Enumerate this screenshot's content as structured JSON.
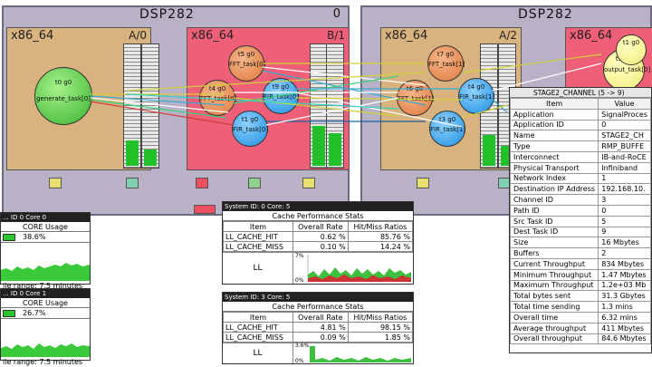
{
  "systems": [
    {
      "title": "DSP282",
      "number": "0",
      "nodes": [
        {
          "label": "x86_64",
          "core": "A/0"
        },
        {
          "label": "x86_64",
          "core": "B/1"
        }
      ],
      "tasks": [
        {
          "id": "t0 g0",
          "name": "generate_task[0]"
        },
        {
          "id": "t5 g0",
          "name": "FFT_task[0]"
        },
        {
          "id": "t4 g0",
          "name": "FFT_task[0]"
        },
        {
          "id": "t9 g0",
          "name": "FIR_task[0]"
        },
        {
          "id": "t1 g0",
          "name": "FIR_task[0]"
        }
      ]
    },
    {
      "title": "DSP282",
      "nodes": [
        {
          "label": "x86_64",
          "core": "A/2"
        },
        {
          "label": "x86_64"
        }
      ],
      "tasks": [
        {
          "id": "t7 g0",
          "name": "FFT_task[1]"
        },
        {
          "id": "t6 g0",
          "name": "FFT_task[1]"
        },
        {
          "id": "t4 g0",
          "name": "FIR_task[1]"
        },
        {
          "id": "t3 g0",
          "name": "FIR_task[1]"
        },
        {
          "id": "t1 g0",
          "name": "output_task[0]"
        },
        {
          "id": "t1 g0",
          "name": ""
        }
      ]
    }
  ],
  "core_windows": [
    {
      "title": "... ID 0 Core 0",
      "heading": "CORE Usage",
      "value": "38.6%",
      "range": "ile range: 7.5 minutes"
    },
    {
      "title": "... ID 0 Core 1",
      "heading": "CORE Usage",
      "value": "26.7%",
      "range": "ile range: 7.5 minutes"
    }
  ],
  "cache_windows": [
    {
      "title": "System ID: 0 Core: 5",
      "heading": "Cache Performance Stats",
      "columns": [
        "Item",
        "Overall Rate",
        "Hit/Miss Ratios"
      ],
      "rows": [
        [
          "LL_CACHE_HIT",
          "0.62 %",
          "85.76 %"
        ],
        [
          "LL_CACHE_MISS",
          "0.10 %",
          "14.24 %"
        ]
      ],
      "graph_label": "LL",
      "graph_max": "7%",
      "graph_min": "0%"
    },
    {
      "title": "System ID: 3 Core: 5",
      "heading": "Cache Performance Stats",
      "columns": [
        "Item",
        "Overall Rate",
        "Hit/Miss Ratios"
      ],
      "rows": [
        [
          "LL_CACHE_HIT",
          "4.81 %",
          "98.15 %"
        ],
        [
          "LL_CACHE_MISS",
          "0.09 %",
          "1.85 %"
        ]
      ],
      "graph_label": "LL",
      "graph_max": "3.6%",
      "graph_min": "0%"
    }
  ],
  "channel_window": {
    "title": "STAGE2_CHANNEL (5 -> 9)",
    "columns": [
      "Item",
      "Value"
    ],
    "rows": [
      [
        "Application",
        "SignalProces"
      ],
      [
        "Application ID",
        "0"
      ],
      [
        "Name",
        "STAGE2_CH"
      ],
      [
        "Type",
        "RMP_BUFFE"
      ],
      [
        "Interconnect",
        "IB-and-RoCE"
      ],
      [
        "Physical Transport",
        "Infiniband"
      ],
      [
        "Network Index",
        "1"
      ],
      [
        "Destination IP Address",
        "192.168.10."
      ],
      [
        "Channel ID",
        "3"
      ],
      [
        "Path ID",
        "0"
      ],
      [
        "Src Task ID",
        "5"
      ],
      [
        "Dest Task ID",
        "9"
      ],
      [
        "Size",
        "16 Mbytes"
      ],
      [
        "Buffers",
        "2"
      ],
      [
        "Current Throughput",
        "834 Mbytes"
      ],
      [
        "Minimum Throughput",
        "1.47 Mbytes"
      ],
      [
        "Maximum Throughput",
        "1.2e+03 Mb"
      ],
      [
        "Total bytes sent",
        "31.3 Gbytes"
      ],
      [
        "Total time sending",
        "1.3 mins"
      ],
      [
        "Overall time",
        "6.32 mins"
      ],
      [
        "Average throughput",
        "411 Mbytes"
      ],
      [
        "Overall throughput",
        "84.6 Mbytes"
      ]
    ]
  },
  "colors": {
    "system_bg": "#b9b1c5",
    "node_tan": "#d9b37f",
    "node_red": "#ef5f77",
    "task_green": "#38b52f",
    "task_orange": "#e07a3e",
    "task_blue": "#1e8fe0",
    "task_yellow": "#f1ec78",
    "usage_green": "#28c928"
  }
}
